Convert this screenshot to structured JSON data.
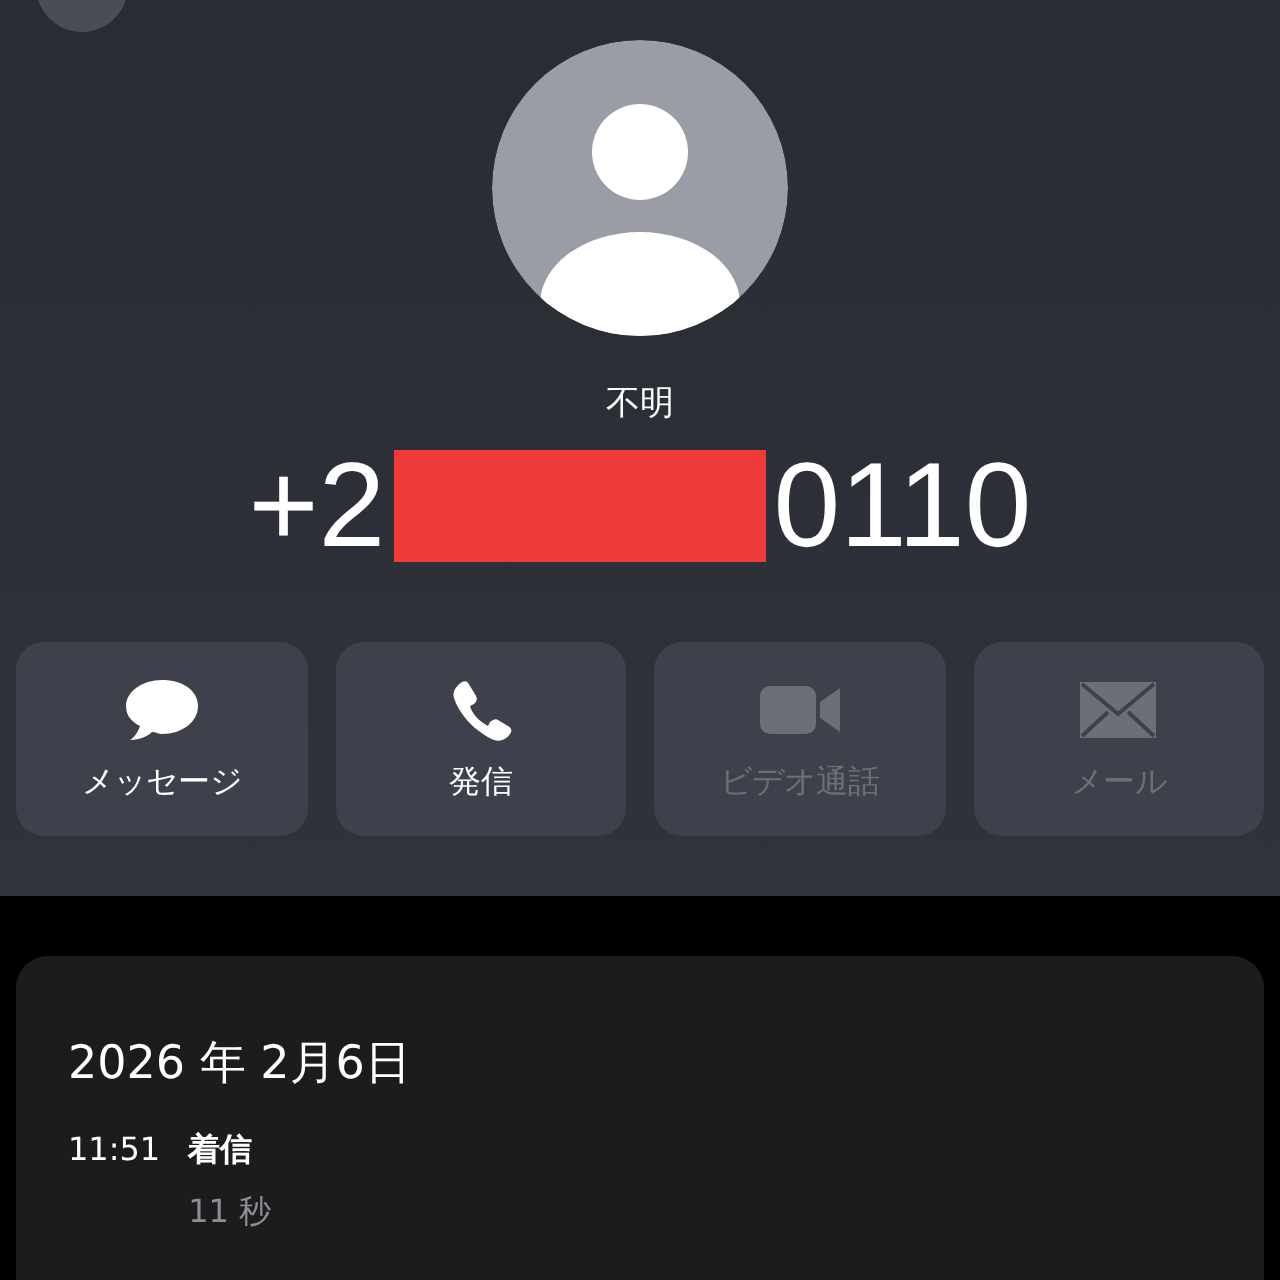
{
  "contact": {
    "name": "不明",
    "number_prefix": "+2",
    "number_redacted": true,
    "number_suffix": "0110"
  },
  "actions": [
    {
      "kind": "message",
      "label": "メッセージ",
      "disabled": false
    },
    {
      "kind": "call",
      "label": "発信",
      "disabled": false
    },
    {
      "kind": "video",
      "label": "ビデオ通話",
      "disabled": true
    },
    {
      "kind": "mail",
      "label": "メール",
      "disabled": true
    }
  ],
  "history": {
    "date": "2026 年 2月6日",
    "entries": [
      {
        "time": "11:51",
        "type": "着信",
        "duration": "11 秒"
      }
    ]
  }
}
